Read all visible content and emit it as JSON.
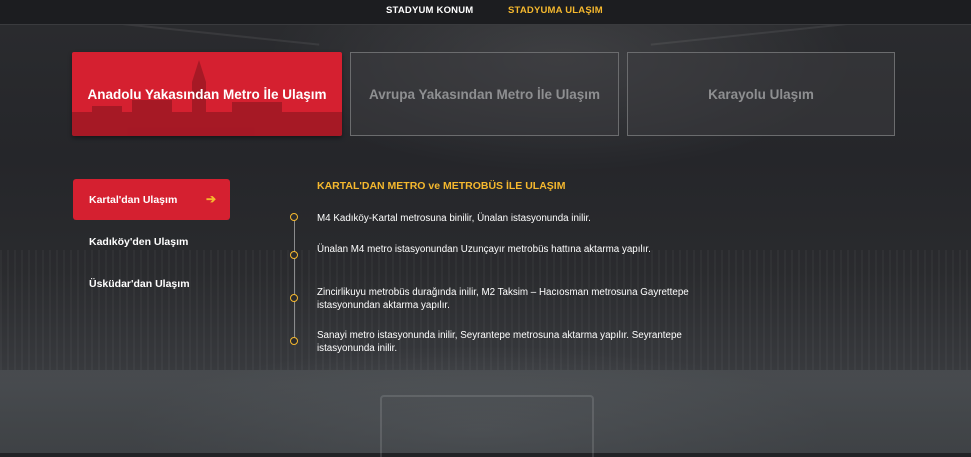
{
  "topnav": {
    "tabs": [
      {
        "label": "STADYUM KONUM",
        "active": false
      },
      {
        "label": "STADYUMA ULAŞIM",
        "active": true
      }
    ]
  },
  "route_cards": [
    {
      "label": "Anadolu Yakasından Metro İle Ulaşım",
      "active": true
    },
    {
      "label": "Avrupa Yakasından Metro İle Ulaşım",
      "active": false
    },
    {
      "label": "Karayolu Ulaşım",
      "active": false
    }
  ],
  "sidebar": {
    "items": [
      {
        "label": "Kartal'dan Ulaşım",
        "active": true
      },
      {
        "label": "Kadıköy'den Ulaşım",
        "active": false
      },
      {
        "label": "Üsküdar'dan Ulaşım",
        "active": false
      }
    ],
    "arrow_icon": "arrow-right-icon"
  },
  "route_detail": {
    "title": "KARTAL'DAN METRO ve METROBÜS İLE ULAŞIM",
    "steps": [
      "M4 Kadıköy-Kartal metrosuna binilir, Ünalan istasyonunda inilir.",
      "Ünalan M4 metro istasyonundan Uzunçayır metrobüs hattına aktarma yapılır.",
      "Zincirlikuyu metrobüs durağında inilir, M2 Taksim – Hacıosman metrosuna Gayrettepe istasyonundan aktarma yapılır.",
      "Sanayi metro istasyonunda inilir, Seyrantepe metrosuna aktarma yapılır. Seyrantepe istasyonunda inilir."
    ]
  },
  "colors": {
    "accent_red": "#d52030",
    "accent_yellow": "#f5b82e",
    "background": "#25262a",
    "inactive_text": "#8e8f91"
  }
}
